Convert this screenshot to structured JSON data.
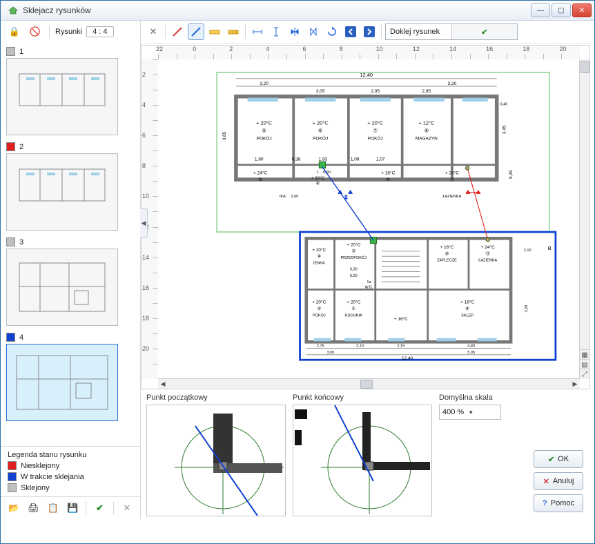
{
  "window": {
    "title": "Sklejacz rysunków"
  },
  "left_toolbar": {
    "label": "Rysunki",
    "counter": "4 : 4"
  },
  "cmd": {
    "text": "Doklej rysunek"
  },
  "hticks": [
    "22",
    "",
    "0",
    "",
    "2",
    "",
    "4",
    "",
    "6",
    "",
    "8",
    "",
    "10",
    "",
    "12",
    "",
    "14",
    "",
    "16",
    "",
    "18",
    "",
    "20"
  ],
  "vticks": [
    "",
    "-2",
    "",
    "-4",
    "",
    "-6",
    "",
    "-8",
    "",
    "-10",
    "",
    "-12",
    "",
    "-14",
    "",
    "-16",
    "",
    "-18",
    "",
    "-20",
    ""
  ],
  "thumbs": [
    {
      "n": "1",
      "color": "#bfbfbf"
    },
    {
      "n": "2",
      "color": "#e02020"
    },
    {
      "n": "3",
      "color": "#bfbfbf"
    },
    {
      "n": "4",
      "color": "#1040d0"
    }
  ],
  "legend": {
    "title": "Legenda stanu rysunku",
    "items": [
      {
        "color": "#e02020",
        "label": "Niesklejony"
      },
      {
        "color": "#1040d0",
        "label": "W trakcie sklejania"
      },
      {
        "color": "#bfbfbf",
        "label": "Sklejony"
      }
    ]
  },
  "details": {
    "start_label": "Punkt początkowy",
    "end_label": "Punkt końcowy",
    "scale_label": "Domyślna skala",
    "scale_value": "400 %"
  },
  "buttons": {
    "ok": "OK",
    "cancel": "Anuluj",
    "help": "Pomoc"
  },
  "plan_upper": {
    "width": "12,40",
    "w1": "3,20",
    "w2": "3,05",
    "w3": "2,95",
    "w4": "2,95",
    "w5": "3,20",
    "rooms": [
      {
        "t": "+ 20°C",
        "n": "5",
        "name": "POKÓJ"
      },
      {
        "t": "+ 20°C",
        "n": "6",
        "name": "POKÓJ"
      },
      {
        "t": "+ 20°C",
        "n": "7",
        "name": "POKÓJ"
      },
      {
        "t": "+ 12°C",
        "n": "8",
        "name": "MAGAZYN"
      }
    ],
    "dims": [
      "1,80",
      "0,38",
      "1,93",
      "1,08",
      "1,07"
    ],
    "lower_rooms": [
      {
        "t": "+ 24°C",
        "n": "3"
      },
      {
        "t": "+ 20°C",
        "n": "4",
        "extra": "1",
        "extra2": "0,90"
      },
      {
        "t": "+ 16°C",
        "n": "10"
      },
      {
        "t": "+ 24°C",
        "n": "11",
        "name": "ŁAZIENKA"
      }
    ],
    "side": {
      "h": "3,45",
      "h2": "3,85",
      "h3": "9,45",
      "w": "0,40"
    },
    "ika": "IKA",
    "ika2": "2,00"
  },
  "plan_lower": {
    "rooms": [
      {
        "t": "+ 20°C",
        "n": "4",
        "name": "IENKA"
      },
      {
        "t": "+ 20°C",
        "n": "3",
        "name": "PRZEDPOKÓJ"
      },
      {
        "t": "+ 16°C",
        "n": "10",
        "name": "ZAPLECZE"
      },
      {
        "t": "+ 24°C",
        "n": "11",
        "name": "ŁAZIENKA"
      }
    ],
    "rooms2": [
      {
        "t": "+ 20°C",
        "n": "2",
        "name": "POKÓJ"
      },
      {
        "t": "+ 20°C",
        "n": "1",
        "name": "KUCHNIA"
      },
      {
        "t": "+ 16°C"
      },
      {
        "t": "+ 16°C",
        "n": "9",
        "name": "SKLEP"
      }
    ],
    "dims": [
      "2,75",
      "2,10",
      "2,15",
      "4,80"
    ],
    "dims2": [
      "3,00",
      "5,05",
      "12,40"
    ],
    "wc": "W.C.",
    "n1a": "1a",
    "d030": "0,30",
    "d020": "0,20",
    "d210": "2,10",
    "d320": "3,20",
    "B": "B"
  }
}
